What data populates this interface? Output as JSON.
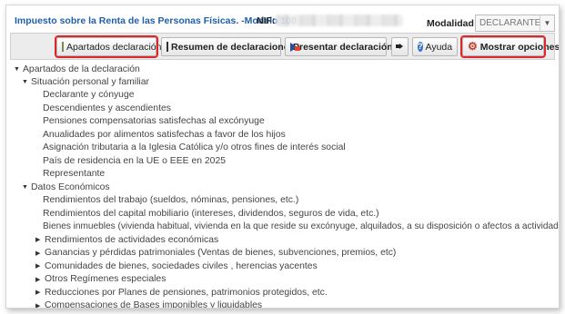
{
  "header": {
    "title": "Impuesto sobre la Renta de las Personas Físicas. -Modelo 100",
    "nif_label": "NIF:",
    "modalidad_label": "Modalidad",
    "modalidad_value": "DECLARANTE",
    "dropdown_arrow": "▼"
  },
  "toolbar": {
    "apartados": "Apartados declaración",
    "resumen": "Resumen de declaraciones",
    "presentar": "Presentar declaración",
    "ayuda": "Ayuda",
    "mostrar": "Mostrar opciones",
    "help_glyph": "?",
    "gear_glyph": "⚙"
  },
  "tree": {
    "caret_expanded": "▼",
    "caret_collapsed": "▶",
    "root": "Apartados de la declaración",
    "situacion": {
      "label": "Situación personal y familiar",
      "items": [
        "Declarante y cónyuge",
        "Descendientes y ascendientes",
        "Pensiones compensatorias satisfechas al excónyuge",
        "Anualidades por alimentos satisfechas a favor de los hijos",
        "Asignación tributaria a la Iglesia Católica y/o otros fines de interés social",
        "País de residencia en la UE o EEE en 2025",
        "Representante"
      ]
    },
    "datos": {
      "label": "Datos Económicos",
      "items": [
        "Rendimientos del trabajo (sueldos, nóminas, pensiones, etc.)",
        "Rendimientos del capital mobiliario (intereses, dividendos, seguros de vida, etc.)",
        "Bienes inmuebles (vivienda habitual, vivienda en la que reside su excónyuge, alquilados, a su disposición o afectos a actividades económicas)"
      ],
      "collapsed": [
        "Rendimientos de actividades económicas",
        "Ganancias y pérdidas patrimoniales (Ventas de bienes, subvenciones, premios, etc)",
        "Comunidades de bienes, sociedades civiles , herencias yacentes",
        "Otros Regímenes especiales",
        "Reducciones por Planes de pensiones, patrimonios protegidos, etc.",
        "Compensaciones de Bases imponibles y liquidables"
      ]
    }
  }
}
